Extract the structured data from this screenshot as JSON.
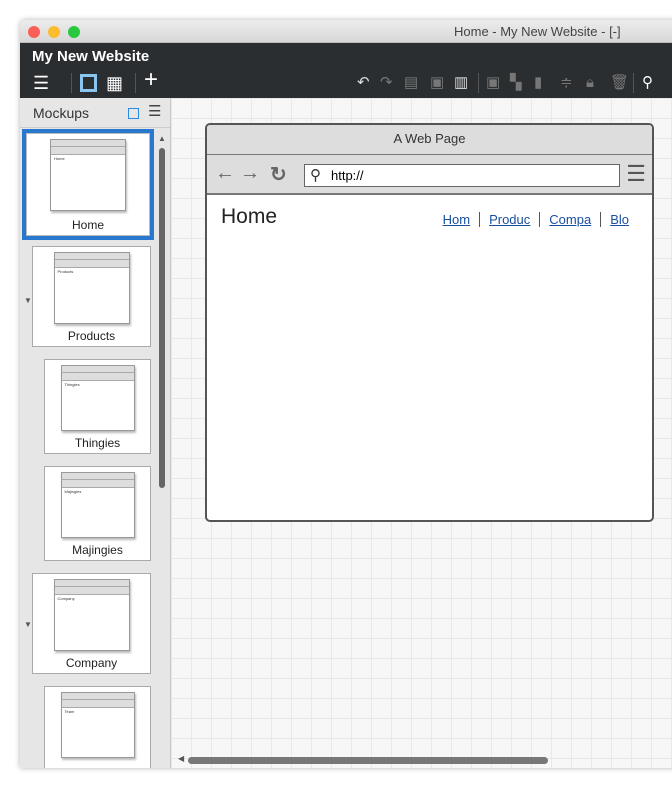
{
  "window": {
    "title": "Home - My New Website - [-]"
  },
  "app": {
    "title": "My New Website"
  },
  "sidebar": {
    "title": "Mockups",
    "items": [
      {
        "label": "Home",
        "heading": "Home",
        "selected": true
      },
      {
        "label": "Products",
        "heading": "Products"
      },
      {
        "label": "Thingies",
        "heading": "Thingies"
      },
      {
        "label": "Majingies",
        "heading": "Majingies"
      },
      {
        "label": "Company",
        "heading": "Company"
      },
      {
        "label": "",
        "heading": "Team"
      }
    ]
  },
  "mockup": {
    "window_title": "A Web Page",
    "url": "http://",
    "heading": "Home",
    "links": [
      "Hom",
      "Produc",
      "Compa",
      "Blo"
    ]
  }
}
